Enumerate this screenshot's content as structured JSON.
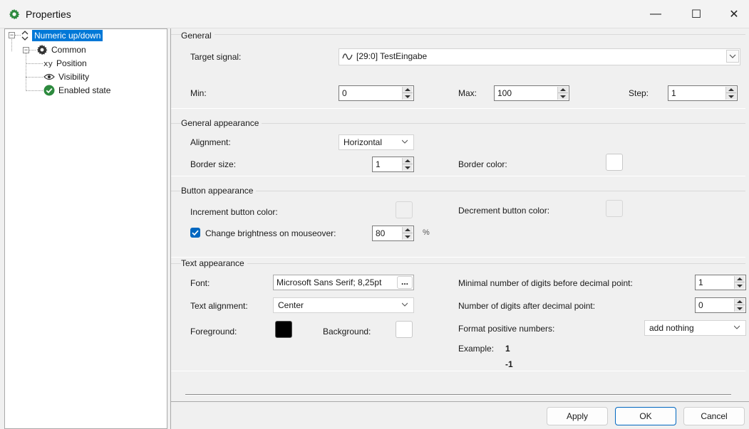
{
  "window": {
    "title": "Properties",
    "minimize_glyph": "—",
    "maximize_glyph": "☐",
    "close_glyph": "✕"
  },
  "tree": {
    "root": "Numeric up/down",
    "common": "Common",
    "items": [
      "Position",
      "Visibility",
      "Enabled state"
    ]
  },
  "general": {
    "title": "General",
    "target_label": "Target signal:",
    "target_value": "[29:0] TestEingabe",
    "min_label": "Min:",
    "min_value": "0",
    "max_label": "Max:",
    "max_value": "100",
    "step_label": "Step:",
    "step_value": "1"
  },
  "general_appearance": {
    "title": "General appearance",
    "alignment_label": "Alignment:",
    "alignment_value": "Horizontal",
    "border_size_label": "Border size:",
    "border_size_value": "1",
    "border_color_label": "Border color:"
  },
  "button_appearance": {
    "title": "Button appearance",
    "increment_label": "Increment button color:",
    "decrement_label": "Decrement button color:",
    "brightness_label": "Change brightness on mouseover:",
    "brightness_checked": true,
    "brightness_value": "80",
    "brightness_unit": "%"
  },
  "text_appearance": {
    "title": "Text appearance",
    "font_label": "Font:",
    "font_value": "Microsoft Sans Serif; 8,25pt",
    "font_button": "...",
    "text_alignment_label": "Text alignment:",
    "text_alignment_value": "Center",
    "foreground_label": "Foreground:",
    "foreground_color": "#000000",
    "background_label": "Background:",
    "background_color": "#ffffff",
    "min_digits_label": "Minimal number of digits before decimal point:",
    "min_digits_value": "1",
    "digits_after_label": "Number of digits after decimal point:",
    "digits_after_value": "0",
    "format_label": "Format positive numbers:",
    "format_value": "add nothing",
    "example_label": "Example:",
    "example_pos": "1",
    "example_neg": "-1"
  },
  "buttons": {
    "apply": "Apply",
    "ok": "OK",
    "cancel": "Cancel"
  },
  "colors": {
    "accent": "#0078d7",
    "checkbox": "#0067c0"
  }
}
